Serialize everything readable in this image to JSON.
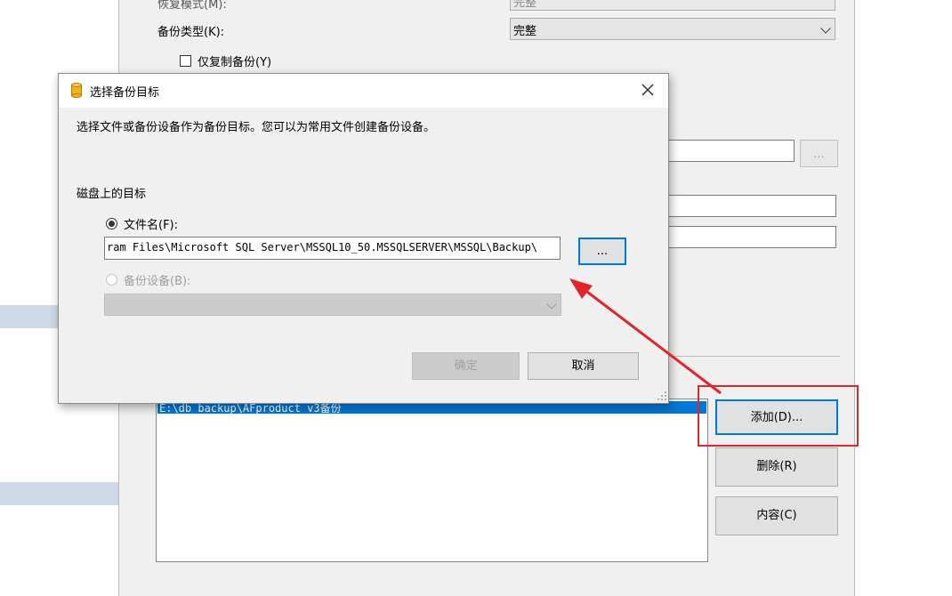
{
  "background": {
    "recovery_model_label": "恢复模式(M):",
    "recovery_model_value": "完整",
    "backup_type_label": "备份类型(K):",
    "backup_type_value": "完整",
    "copy_only_label": "仅复制备份(Y)",
    "destination_item": "E:\\db_backup\\AFproduct_v3备份",
    "add_button": "添加(D)...",
    "remove_button": "删除(R)",
    "contents_button": "内容(C)",
    "browse_button": "..."
  },
  "modal": {
    "title": "选择备份目标",
    "description": "选择文件或备份设备作为备份目标。您可以为常用文件创建备份设备。",
    "disk_section": "磁盘上的目标",
    "file_name_label": "文件名(F):",
    "file_path": "ram Files\\Microsoft SQL Server\\MSSQL10_50.MSSQLSERVER\\MSSQL\\Backup\\",
    "browse_button": "...",
    "backup_device_label": "备份设备(B):",
    "ok_button": "确定",
    "cancel_button": "取消",
    "close_icon": "close-icon",
    "app_icon": "database-icon"
  },
  "colors": {
    "annotation_red": "#e0262b",
    "selection_blue": "#0078d7"
  }
}
